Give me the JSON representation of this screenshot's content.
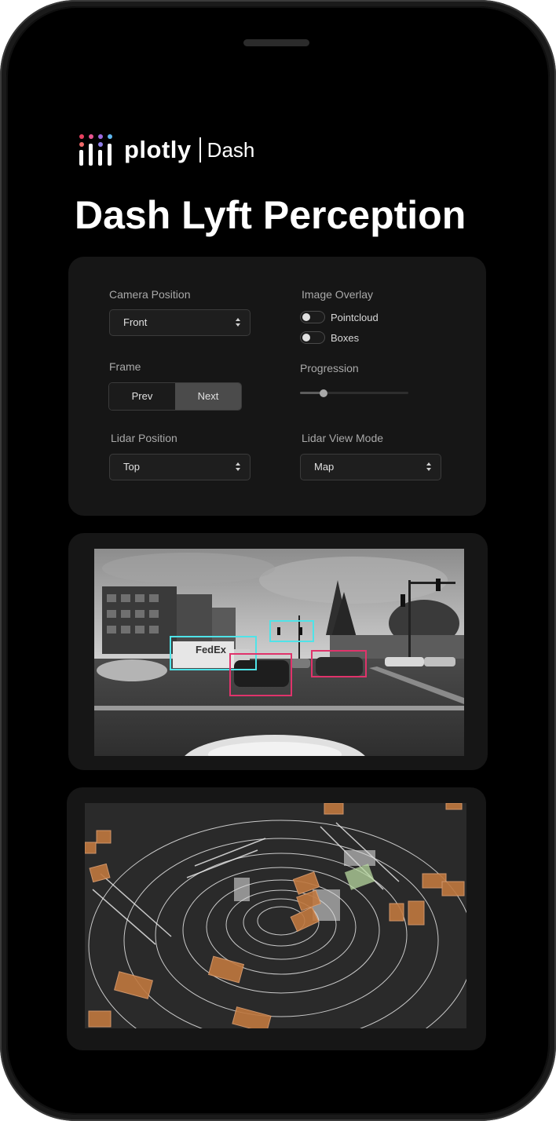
{
  "app": {
    "logo_text": "plotly",
    "logo_dash": "Dash",
    "title": "Dash Lyft Perception"
  },
  "controls": {
    "camera_position": {
      "label": "Camera Position",
      "value": "Front"
    },
    "image_overlay": {
      "label": "Image Overlay",
      "options": [
        {
          "label": "Pointcloud",
          "enabled": false
        },
        {
          "label": "Boxes",
          "enabled": false
        }
      ]
    },
    "frame": {
      "label": "Frame",
      "prev_label": "Prev",
      "next_label": "Next",
      "active": "Next"
    },
    "progression": {
      "label": "Progression",
      "value_fraction": 0.22
    },
    "lidar_position": {
      "label": "Lidar Position",
      "value": "Top"
    },
    "lidar_view_mode": {
      "label": "Lidar View Mode",
      "value": "Map"
    }
  },
  "camera_view": {
    "detected_text": "FedEx"
  },
  "colors": {
    "page_background": "#000000",
    "card_background": "#161616",
    "cyan_box": "#4fe3e8",
    "pink_box": "#e0336b",
    "lidar_box": "#c0783f"
  }
}
